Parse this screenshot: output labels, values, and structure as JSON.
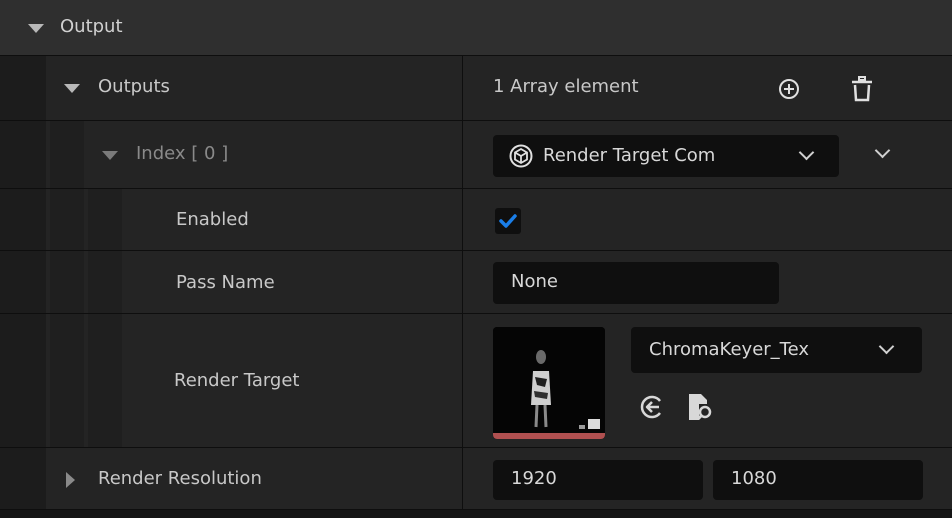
{
  "category": {
    "label": "Output"
  },
  "outputs": {
    "label": "Outputs",
    "array_count_text": "1 Array element",
    "add_icon": "plus-circle-icon",
    "delete_icon": "trash-icon"
  },
  "index_row": {
    "label": "Index [ 0 ]",
    "selected_class": "Render Target Com",
    "class_icon": "component-icon"
  },
  "enabled": {
    "label": "Enabled",
    "checked": true
  },
  "pass_name": {
    "label": "Pass Name",
    "value": "None"
  },
  "render_target": {
    "label": "Render Target",
    "asset_name": "ChromaKeyer_Tex",
    "use_selected_icon": "use-selected-arrow-icon",
    "browse_icon": "browse-asset-icon"
  },
  "render_resolution": {
    "label": "Render Resolution",
    "x": "1920",
    "y": "1080"
  },
  "colors": {
    "accent_check": "#1a7ee8",
    "panel_bg": "#242424",
    "field_bg": "#0f0f0f"
  }
}
